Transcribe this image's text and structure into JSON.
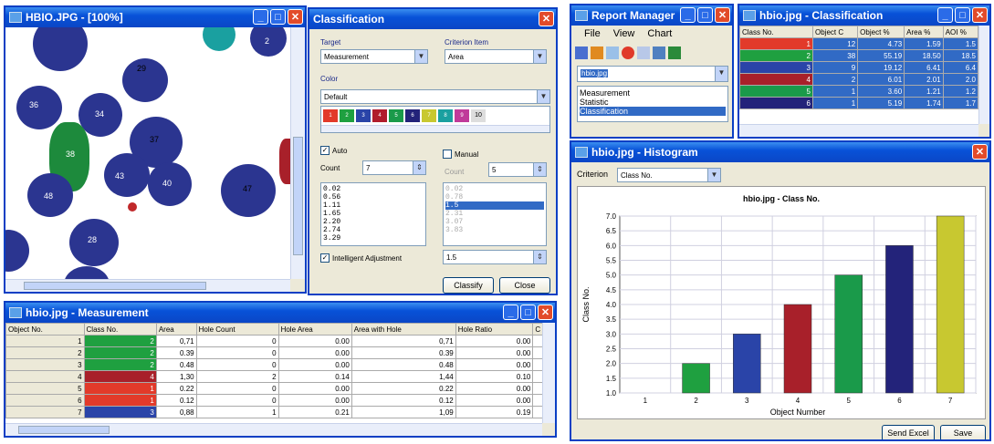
{
  "image_window": {
    "title": "HBIO.JPG - [100%]",
    "labels": [
      "29",
      "34",
      "37",
      "38",
      "43",
      "40",
      "47",
      "48",
      "28",
      "36",
      "39",
      "30",
      "2"
    ]
  },
  "classification": {
    "title": "Classification",
    "target_label": "Target",
    "target_value": "Measurement",
    "criterion_label": "Criterion Item",
    "criterion_value": "Area",
    "color_label": "Color",
    "color_value": "Default",
    "swatch_colors": [
      "#e23a2a",
      "#1fa040",
      "#2a44a8",
      "#b01c2c",
      "#1a9a4a",
      "#23237a",
      "#c8c830",
      "#1aa0a0",
      "#c03a9a"
    ],
    "swatch_numbers": [
      "1",
      "2",
      "3",
      "4",
      "5",
      "6",
      "7",
      "8",
      "9",
      "10"
    ],
    "auto_label": "Auto",
    "manual_label": "Manual",
    "count_label": "Count",
    "auto_count": "7",
    "manual_count": "5",
    "auto_values": [
      "0.02",
      "0.56",
      "1.11",
      "1.65",
      "2.20",
      "2.74",
      "3.29"
    ],
    "manual_values": [
      "0.02",
      "0.78",
      "1.5",
      "2.31",
      "3.07",
      "3.83"
    ],
    "manual_selected": "1.5",
    "manual_input": "1.5",
    "intelligent_label": "Intelligent Adjustment",
    "classify_label": "Classify",
    "close_label": "Close"
  },
  "measurement": {
    "title": "hbio.jpg - Measurement",
    "columns": [
      "Object No.",
      "Class No.",
      "Area",
      "Hole Count",
      "Hole Area",
      "Area with Hole",
      "Hole Ratio",
      "C"
    ],
    "rows": [
      {
        "obj": "1",
        "class": "2",
        "color": "#1fa040",
        "area": "0,71",
        "hc": "0",
        "ha": "0.00",
        "awh": "0,71",
        "hr": "0.00"
      },
      {
        "obj": "2",
        "class": "2",
        "color": "#1fa040",
        "area": "0.39",
        "hc": "0",
        "ha": "0.00",
        "awh": "0.39",
        "hr": "0.00"
      },
      {
        "obj": "3",
        "class": "2",
        "color": "#1fa040",
        "area": "0.48",
        "hc": "0",
        "ha": "0.00",
        "awh": "0.48",
        "hr": "0.00"
      },
      {
        "obj": "4",
        "class": "4",
        "color": "#a8202a",
        "area": "1,30",
        "hc": "2",
        "ha": "0.14",
        "awh": "1,44",
        "hr": "0.10"
      },
      {
        "obj": "5",
        "class": "1",
        "color": "#e23a2a",
        "area": "0.22",
        "hc": "0",
        "ha": "0.00",
        "awh": "0.22",
        "hr": "0.00"
      },
      {
        "obj": "6",
        "class": "1",
        "color": "#e23a2a",
        "area": "0.12",
        "hc": "0",
        "ha": "0.00",
        "awh": "0.12",
        "hr": "0.00"
      },
      {
        "obj": "7",
        "class": "3",
        "color": "#2a44a8",
        "area": "0,88",
        "hc": "1",
        "ha": "0.21",
        "awh": "1,09",
        "hr": "0.19"
      }
    ]
  },
  "report_manager": {
    "title": "Report Manager",
    "menu": [
      "File",
      "View",
      "Chart"
    ],
    "combo_value": "hbio.jpg",
    "list": [
      "Measurement",
      "Statistic",
      "Classification"
    ],
    "selected": "Classification"
  },
  "class_table": {
    "title": "hbio.jpg - Classification",
    "columns": [
      "Class No.",
      "Object C",
      "Object %",
      "Area %",
      "AOI %"
    ],
    "rows": [
      {
        "cls": "1",
        "color": "#e23a2a",
        "oc": "12",
        "op": "4.73",
        "ap": "1.59",
        "aoi": "1.5"
      },
      {
        "cls": "2",
        "color": "#1fa040",
        "oc": "38",
        "op": "55.19",
        "ap": "18.50",
        "aoi": "18.5"
      },
      {
        "cls": "3",
        "color": "#2a44a8",
        "oc": "9",
        "op": "19.12",
        "ap": "6.41",
        "aoi": "6.4"
      },
      {
        "cls": "4",
        "color": "#a8202a",
        "oc": "2",
        "op": "6.01",
        "ap": "2.01",
        "aoi": "2.0"
      },
      {
        "cls": "5",
        "color": "#1a9a4a",
        "oc": "1",
        "op": "3.60",
        "ap": "1.21",
        "aoi": "1.2"
      },
      {
        "cls": "6",
        "color": "#23237a",
        "oc": "1",
        "op": "5.19",
        "ap": "1.74",
        "aoi": "1.7"
      }
    ]
  },
  "histogram": {
    "title": "hbio.jpg - Histogram",
    "criterion_label": "Criterion",
    "criterion_value": "Class No.",
    "send_excel_label": "Send Excel",
    "save_label": "Save"
  },
  "chart_data": {
    "type": "bar",
    "title": "hbio.jpg - Class No.",
    "xlabel": "Object Number",
    "ylabel": "Class No.",
    "categories": [
      "1",
      "2",
      "3",
      "4",
      "5",
      "6",
      "7"
    ],
    "values": [
      null,
      2.0,
      3.0,
      4.0,
      5.0,
      6.0,
      7.0
    ],
    "colors": [
      "#e23a2a",
      "#1fa040",
      "#2a44a8",
      "#a8202a",
      "#1a9a4a",
      "#23237a",
      "#c8c830"
    ],
    "ylim": [
      1.0,
      7.0
    ],
    "yticks": [
      "1.0",
      "1.5",
      "2.0",
      "2.5",
      "3.0",
      "3.5",
      "4.0",
      "4.5",
      "5.0",
      "5.5",
      "6.0",
      "6.5",
      "7.0"
    ],
    "grid": true
  }
}
